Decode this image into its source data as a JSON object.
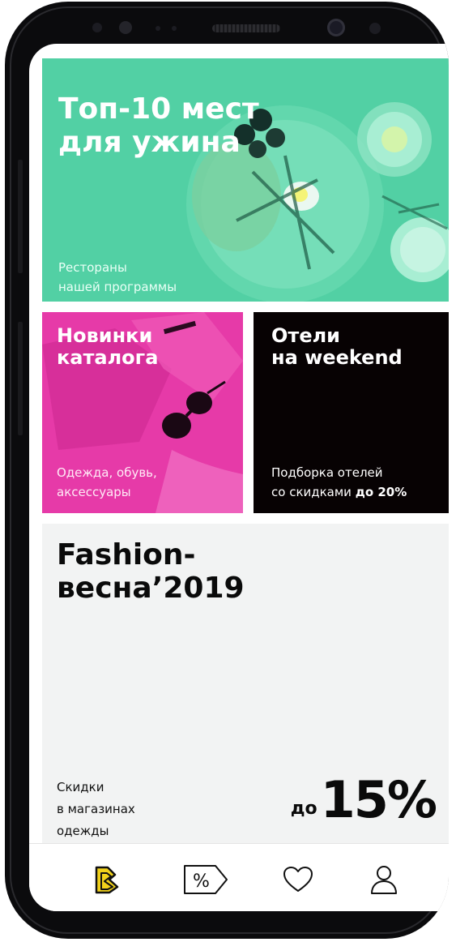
{
  "colors": {
    "dinner_bg": "#52d0a4",
    "catalog_bg": "#e63aa8",
    "hotels_bg": "#070203",
    "fashion_bg": "#f2f3f3",
    "brand_yellow": "#f2d21b"
  },
  "cards": {
    "dinner": {
      "title_line1": "Топ-10 мест",
      "title_line2": "для ужина",
      "sub_line1": "Рестораны",
      "sub_line2": "нашей программы"
    },
    "catalog": {
      "title_line1": "Новинки",
      "title_line2": "каталога",
      "sub_line1": "Одежда, обувь,",
      "sub_line2": "аксессуары"
    },
    "hotels": {
      "title_line1": "Отели",
      "title_line2": "на weekend",
      "sub_line1": "Подборка отелей",
      "sub_line2_a": "со скидками ",
      "sub_line2_b": "до 20%"
    },
    "fashion": {
      "title_line1": "Fashion-",
      "title_line2": "весна’2019",
      "sub_line1": "Скидки",
      "sub_line2": "в магазинах",
      "sub_line3": "одежды",
      "discount_prefix": "до",
      "discount_value": "15%"
    }
  },
  "tabbar": {
    "items": [
      {
        "icon": "brand-logo-icon",
        "active": true
      },
      {
        "icon": "discount-tag-icon",
        "active": false
      },
      {
        "icon": "heart-icon",
        "active": false
      },
      {
        "icon": "profile-icon",
        "active": false
      }
    ]
  }
}
